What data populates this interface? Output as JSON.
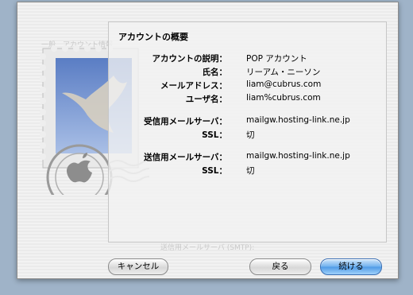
{
  "summary": {
    "title": "アカウントの概要",
    "rows": [
      {
        "label": "アカウントの説明：",
        "value": "POP アカウント"
      },
      {
        "label": "氏名：",
        "value": "リーアム・ニーソン"
      },
      {
        "label": "メールアドレス：",
        "value": "liam@cubrus.com"
      },
      {
        "label": "ユーザ名：",
        "value": "liam%cubrus.com"
      },
      {
        "label": "受信用メールサーバ：",
        "value": "mailgw.hosting-link.ne.jp"
      },
      {
        "label": "SSL：",
        "value": "切"
      },
      {
        "label": "送信用メールサーバ：",
        "value": "mailgw.hosting-link.ne.jp"
      },
      {
        "label": "SSL：",
        "value": "切"
      }
    ]
  },
  "buttons": {
    "cancel": "キャンセル",
    "back": "戻る",
    "continue": "続ける"
  },
  "colors": {
    "desktop": "#9fb3c8",
    "primary_button": "#5aa2ea"
  },
  "icons": {
    "stamp": "mail-stamp-eagle"
  }
}
